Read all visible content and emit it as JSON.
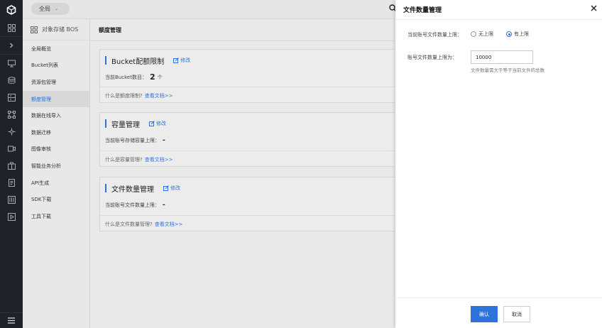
{
  "topbar": {
    "region_label": "全局"
  },
  "subnav": {
    "title": "对象存储 BOS",
    "items": [
      {
        "label": "全局概览"
      },
      {
        "label": "Bucket列表"
      },
      {
        "label": "资源包管理"
      },
      {
        "label": "额度管理",
        "active": true
      },
      {
        "label": "数据在线导入"
      },
      {
        "label": "数据迁移"
      },
      {
        "label": "图像审核"
      },
      {
        "label": "智能业务分析"
      },
      {
        "label": "API生成"
      },
      {
        "label": "SDK下载"
      },
      {
        "label": "工具下载"
      }
    ]
  },
  "main": {
    "title": "额度管理",
    "cards": [
      {
        "title": "Bucket配额限制",
        "edit_label": "修改",
        "row_label": "当前Bucket数目：",
        "row_value": "2",
        "row_unit": "个",
        "help_text": "什么是额度限制?",
        "help_link": "查看文档>>"
      },
      {
        "title": "容量管理",
        "edit_label": "修改",
        "row_label": "当前账号存储容量上限：",
        "row_value": "-",
        "help_text": "什么是容量管理?",
        "help_link": "查看文档>>"
      },
      {
        "title": "文件数量管理",
        "edit_label": "修改",
        "row_label": "当前账号文件数量上限：",
        "row_value": "-",
        "help_text": "什么是文件数量管理?",
        "help_link": "查看文档>>"
      }
    ]
  },
  "drawer": {
    "title": "文件数量管理",
    "limit_label": "当前账号文件数量上限：",
    "option_unlimited": "无上限",
    "option_limited": "有上限",
    "selected": "limited",
    "count_label": "账号文件数量上限为：",
    "count_value": "10000",
    "hint": "文件数量需大于等于当前文件的总数",
    "confirm_label": "确认",
    "cancel_label": "取消"
  },
  "colors": {
    "accent": "#2d73d9",
    "rail": "#1f2329"
  }
}
